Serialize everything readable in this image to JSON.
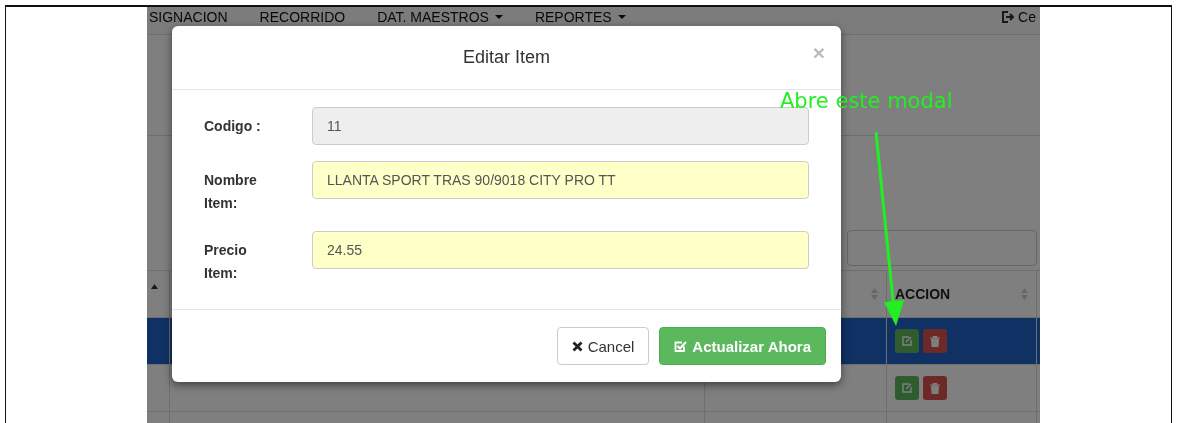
{
  "navbar": {
    "items": [
      {
        "label": "SIGNACION",
        "dropdown": false
      },
      {
        "label": "RECORRIDO",
        "dropdown": false
      },
      {
        "label": "DAT. MAESTROS",
        "dropdown": true
      },
      {
        "label": "REPORTES",
        "dropdown": true
      }
    ],
    "logout": "Ce"
  },
  "table": {
    "action_header": "ACCION",
    "rows": [
      {
        "selected": true
      },
      {
        "selected": false
      },
      {
        "selected": false
      }
    ]
  },
  "modal": {
    "title": "Editar Item",
    "close": "×",
    "fields": [
      {
        "label": "Codigo :",
        "value": "11",
        "disabled": true
      },
      {
        "label": "Nombre Item:",
        "value": "LLANTA SPORT TRAS 90/9018 CITY PRO TT",
        "disabled": false
      },
      {
        "label": "Precio Item:",
        "value": "24.55",
        "disabled": false
      }
    ],
    "buttons": [
      {
        "label": "Cancel",
        "kind": "default"
      },
      {
        "label": "Actualizar Ahora",
        "kind": "primary"
      }
    ]
  },
  "annotation": {
    "text": "Abre este modal"
  }
}
